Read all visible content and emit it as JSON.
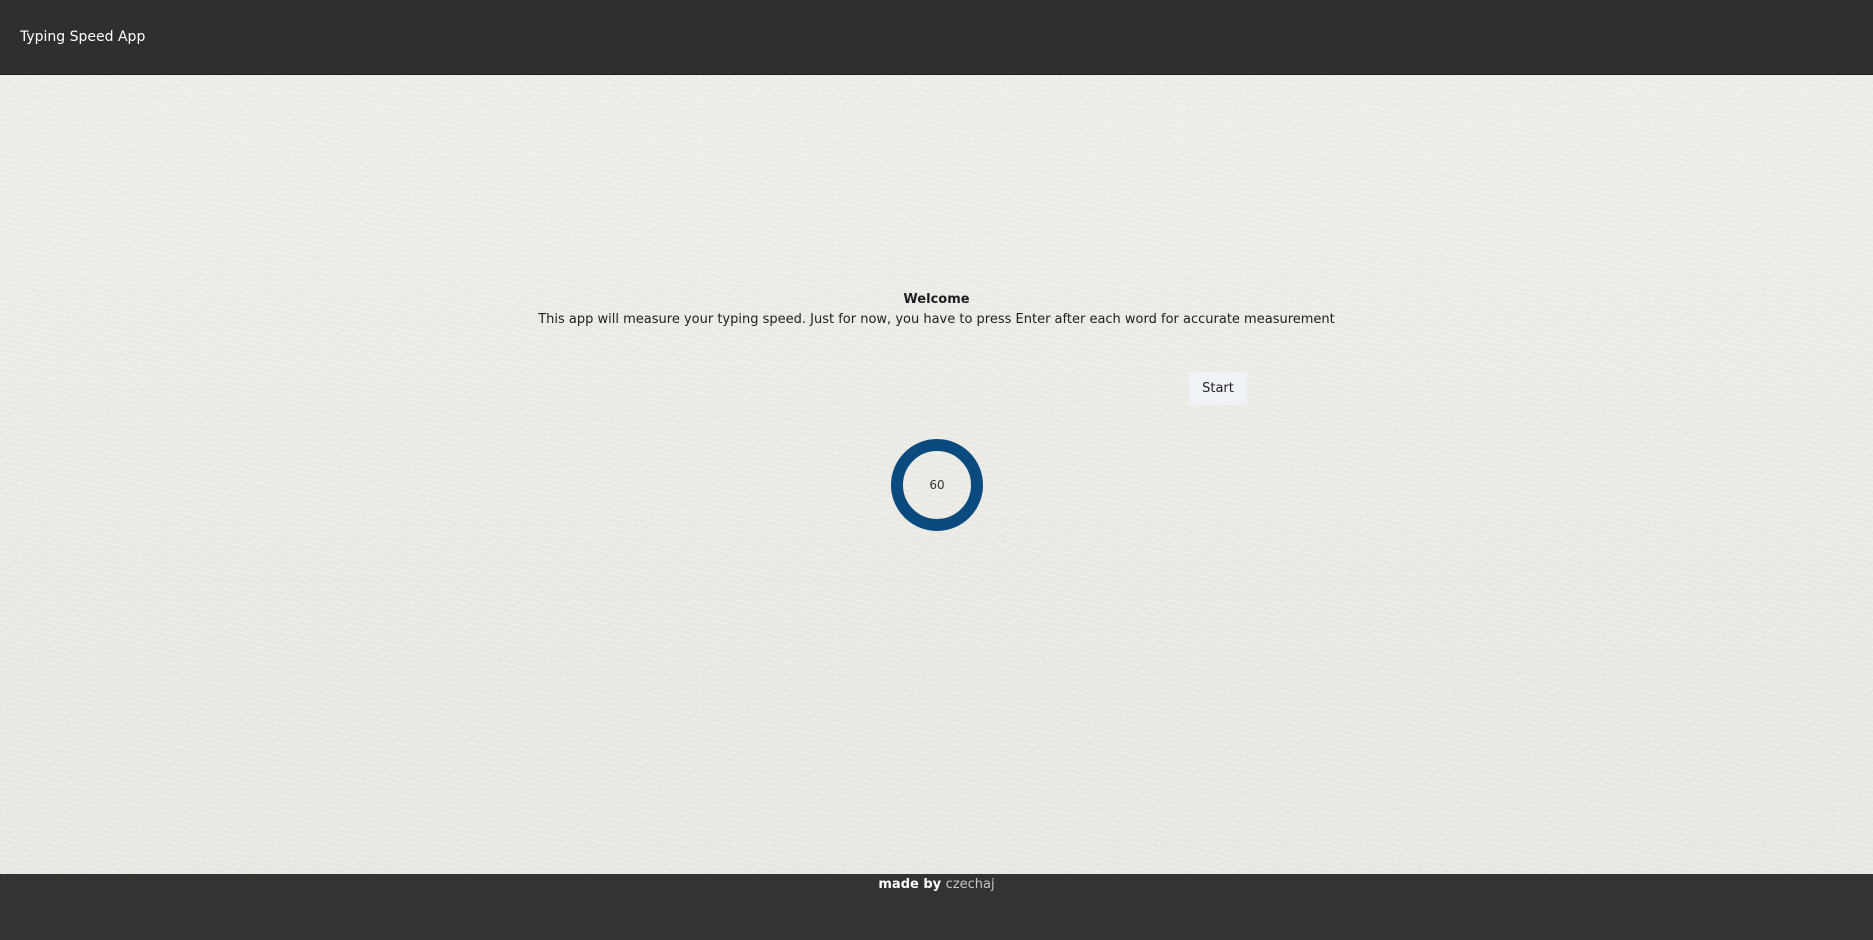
{
  "header": {
    "title": "Typing Speed App"
  },
  "main": {
    "welcome_heading": "Welcome",
    "welcome_text": "This app will measure your typing speed. Just for now, you have to press Enter after each word for accurate measurement",
    "start_label": "Start",
    "timer_value": "60"
  },
  "footer": {
    "made_by_label": "made by",
    "author": "czechaj"
  },
  "colors": {
    "header_background": "#2f2f2e",
    "footer_background": "#333331",
    "main_background": "#ecebe7",
    "timer_ring": "#0b4a7e",
    "start_button_background": "#eff2f6"
  }
}
